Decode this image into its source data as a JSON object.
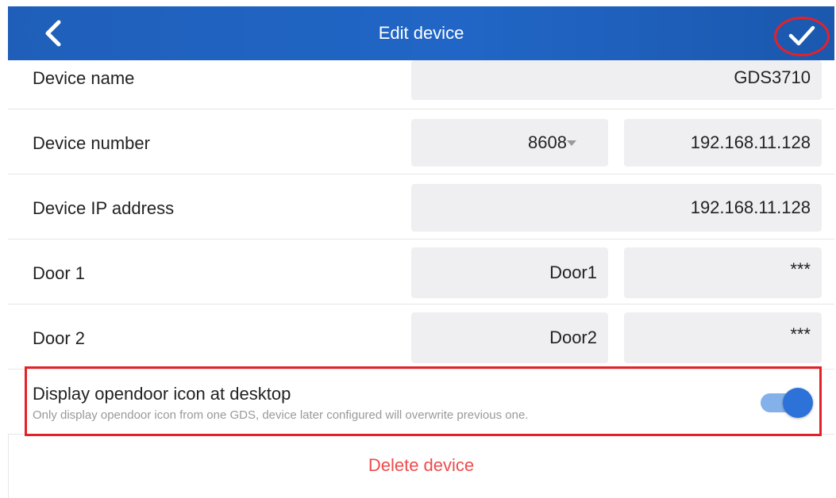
{
  "header": {
    "title": "Edit device",
    "accent_color": "#2166c6",
    "back_icon": "chevron-left-icon",
    "confirm_icon": "check-icon",
    "annotation_color": "#e52128"
  },
  "rows": {
    "device_name": {
      "label": "Device name",
      "value": "GDS3710"
    },
    "device_number": {
      "label": "Device number",
      "number": "8608",
      "ip": "192.168.11.128"
    },
    "device_ip": {
      "label": "Device IP address",
      "value": "192.168.11.128"
    },
    "door1": {
      "label": "Door 1",
      "name": "Door1",
      "password": "***"
    },
    "door2": {
      "label": "Door 2",
      "name": "Door2",
      "password": "***"
    }
  },
  "option": {
    "title": "Display opendoor icon at desktop",
    "description": "Only display opendoor icon from one GDS, device later configured will overwrite previous one.",
    "enabled": true,
    "toggle_color": "#2c72d8"
  },
  "delete_label": "Delete device",
  "delete_color": "#ef4b4b"
}
